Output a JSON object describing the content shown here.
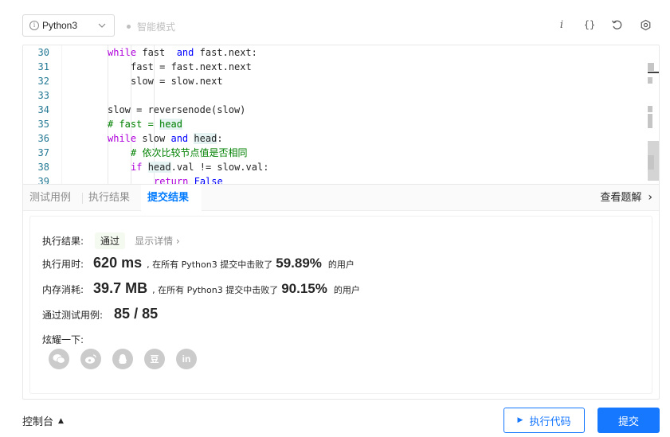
{
  "toolbar": {
    "language": "Python3",
    "smart_mode": "智能模式",
    "icons": [
      "info-icon",
      "braces-icon",
      "reset-icon",
      "settings-icon"
    ]
  },
  "editor": {
    "lines": [
      {
        "n": "30",
        "parts": [
          {
            "t": "while",
            "c": "kw2"
          },
          {
            "t": " fast  ",
            "c": ""
          },
          {
            "t": "and",
            "c": "kw"
          },
          {
            "t": " fast.next:",
            "c": ""
          }
        ]
      },
      {
        "n": "31",
        "parts": [
          {
            "t": "fast = fast.next.next",
            "c": ""
          }
        ]
      },
      {
        "n": "32",
        "parts": [
          {
            "t": "slow = slow.next",
            "c": ""
          }
        ]
      },
      {
        "n": "33",
        "parts": []
      },
      {
        "n": "34",
        "parts": [
          {
            "t": "slow = reversenode(slow)",
            "c": ""
          }
        ]
      },
      {
        "n": "35",
        "parts": [
          {
            "t": "# fast = ",
            "c": "cm"
          },
          {
            "t": "head",
            "c": "cm hl"
          }
        ]
      },
      {
        "n": "36",
        "parts": [
          {
            "t": "while",
            "c": "kw2"
          },
          {
            "t": " slow ",
            "c": ""
          },
          {
            "t": "and",
            "c": "kw"
          },
          {
            "t": " ",
            "c": ""
          },
          {
            "t": "head",
            "c": "hl"
          },
          {
            "t": ":",
            "c": ""
          }
        ]
      },
      {
        "n": "37",
        "parts": [
          {
            "t": "# 依次比较节点值是否相同",
            "c": "cm"
          }
        ]
      },
      {
        "n": "38",
        "parts": [
          {
            "t": "if",
            "c": "kw2"
          },
          {
            "t": " ",
            "c": ""
          },
          {
            "t": "head",
            "c": "hl"
          },
          {
            "t": ".val != slow.val:",
            "c": ""
          }
        ]
      },
      {
        "n": "39",
        "parts": [
          {
            "t": "return",
            "c": "kw2"
          },
          {
            "t": " ",
            "c": ""
          },
          {
            "t": "False",
            "c": "kw"
          }
        ]
      }
    ]
  },
  "tabs": {
    "test_cases": "测试用例",
    "run_result": "执行结果",
    "submit_result": "提交结果",
    "see_solution": "查看题解"
  },
  "result": {
    "status_label": "执行结果:",
    "status": "通过",
    "show_details": "显示详情 ›",
    "runtime_label": "执行用时:",
    "runtime": "620 ms",
    "runtime_beat_pre": ", 在所有 Python3 提交中击败了",
    "runtime_pct": "59.89%",
    "runtime_beat_post": "的用户",
    "memory_label": "内存消耗:",
    "memory": "39.7 MB",
    "memory_beat_pre": ", 在所有 Python3 提交中击败了",
    "memory_pct": "90.15%",
    "memory_beat_post": "的用户",
    "cases_label": "通过测试用例:",
    "cases": "85 / 85",
    "share_label": "炫耀一下:",
    "share_icons": [
      "wechat-icon",
      "weibo-icon",
      "qq-icon",
      "douban-icon",
      "linkedin-icon"
    ]
  },
  "footer": {
    "console": "控制台",
    "run_code": "执行代码",
    "submit": "提交"
  },
  "colors": {
    "accent": "#1677ff",
    "active_tab": "#007aff"
  }
}
